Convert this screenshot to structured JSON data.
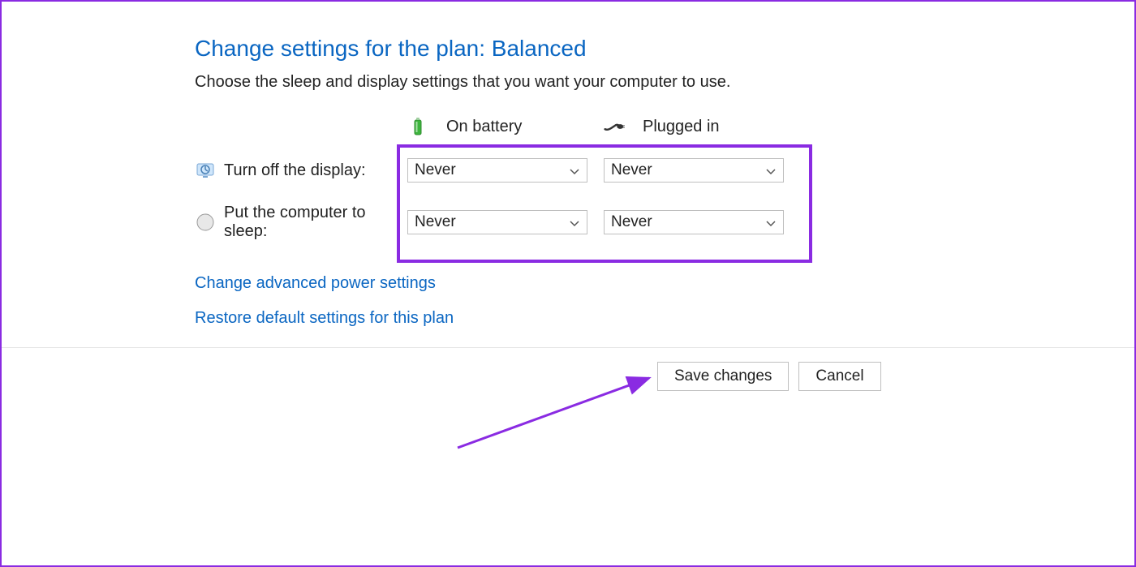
{
  "title": "Change settings for the plan: Balanced",
  "subtitle": "Choose the sleep and display settings that you want your computer to use.",
  "columns": {
    "battery": "On battery",
    "plugged": "Plugged in"
  },
  "rows": {
    "display": {
      "label": "Turn off the display:",
      "battery_value": "Never",
      "plugged_value": "Never"
    },
    "sleep": {
      "label": "Put the computer to sleep:",
      "battery_value": "Never",
      "plugged_value": "Never"
    }
  },
  "links": {
    "advanced": "Change advanced power settings",
    "restore": "Restore default settings for this plan"
  },
  "buttons": {
    "save": "Save changes",
    "cancel": "Cancel"
  }
}
